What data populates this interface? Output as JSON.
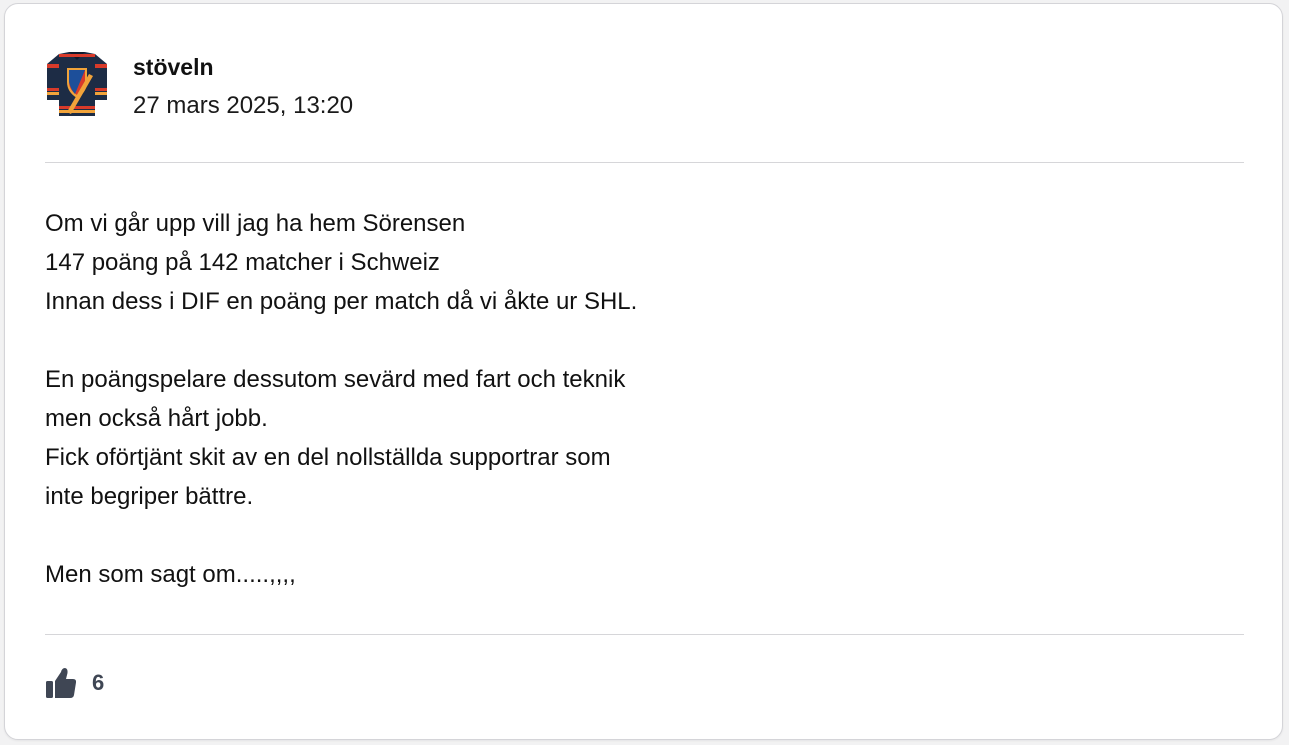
{
  "post": {
    "author": "stöveln",
    "timestamp": "27 mars 2025, 13:20",
    "avatar_icon": "hockey-jersey-icon",
    "paragraphs": [
      [
        "Om vi går upp vill jag ha hem Sörensen",
        "147 poäng på 142 matcher i Schweiz",
        "Innan dess i DIF en poäng per match då vi åkte ur SHL."
      ],
      [
        "En poängspelare dessutom sevärd med fart och teknik",
        "men också hårt jobb.",
        "Fick oförtjänt skit av en del nollställda supportrar som",
        "inte begriper bättre."
      ],
      [
        "Men som sagt om.....,,,,"
      ]
    ],
    "reactions": {
      "like_icon": "thumbs-up-icon",
      "like_count": "6"
    }
  },
  "colors": {
    "text": "#111111",
    "divider": "#d6d6d9",
    "like_gray": "#3f4654",
    "jersey_navy": "#1d2c45",
    "jersey_red": "#d83a2a",
    "jersey_orange": "#f1a33a"
  }
}
